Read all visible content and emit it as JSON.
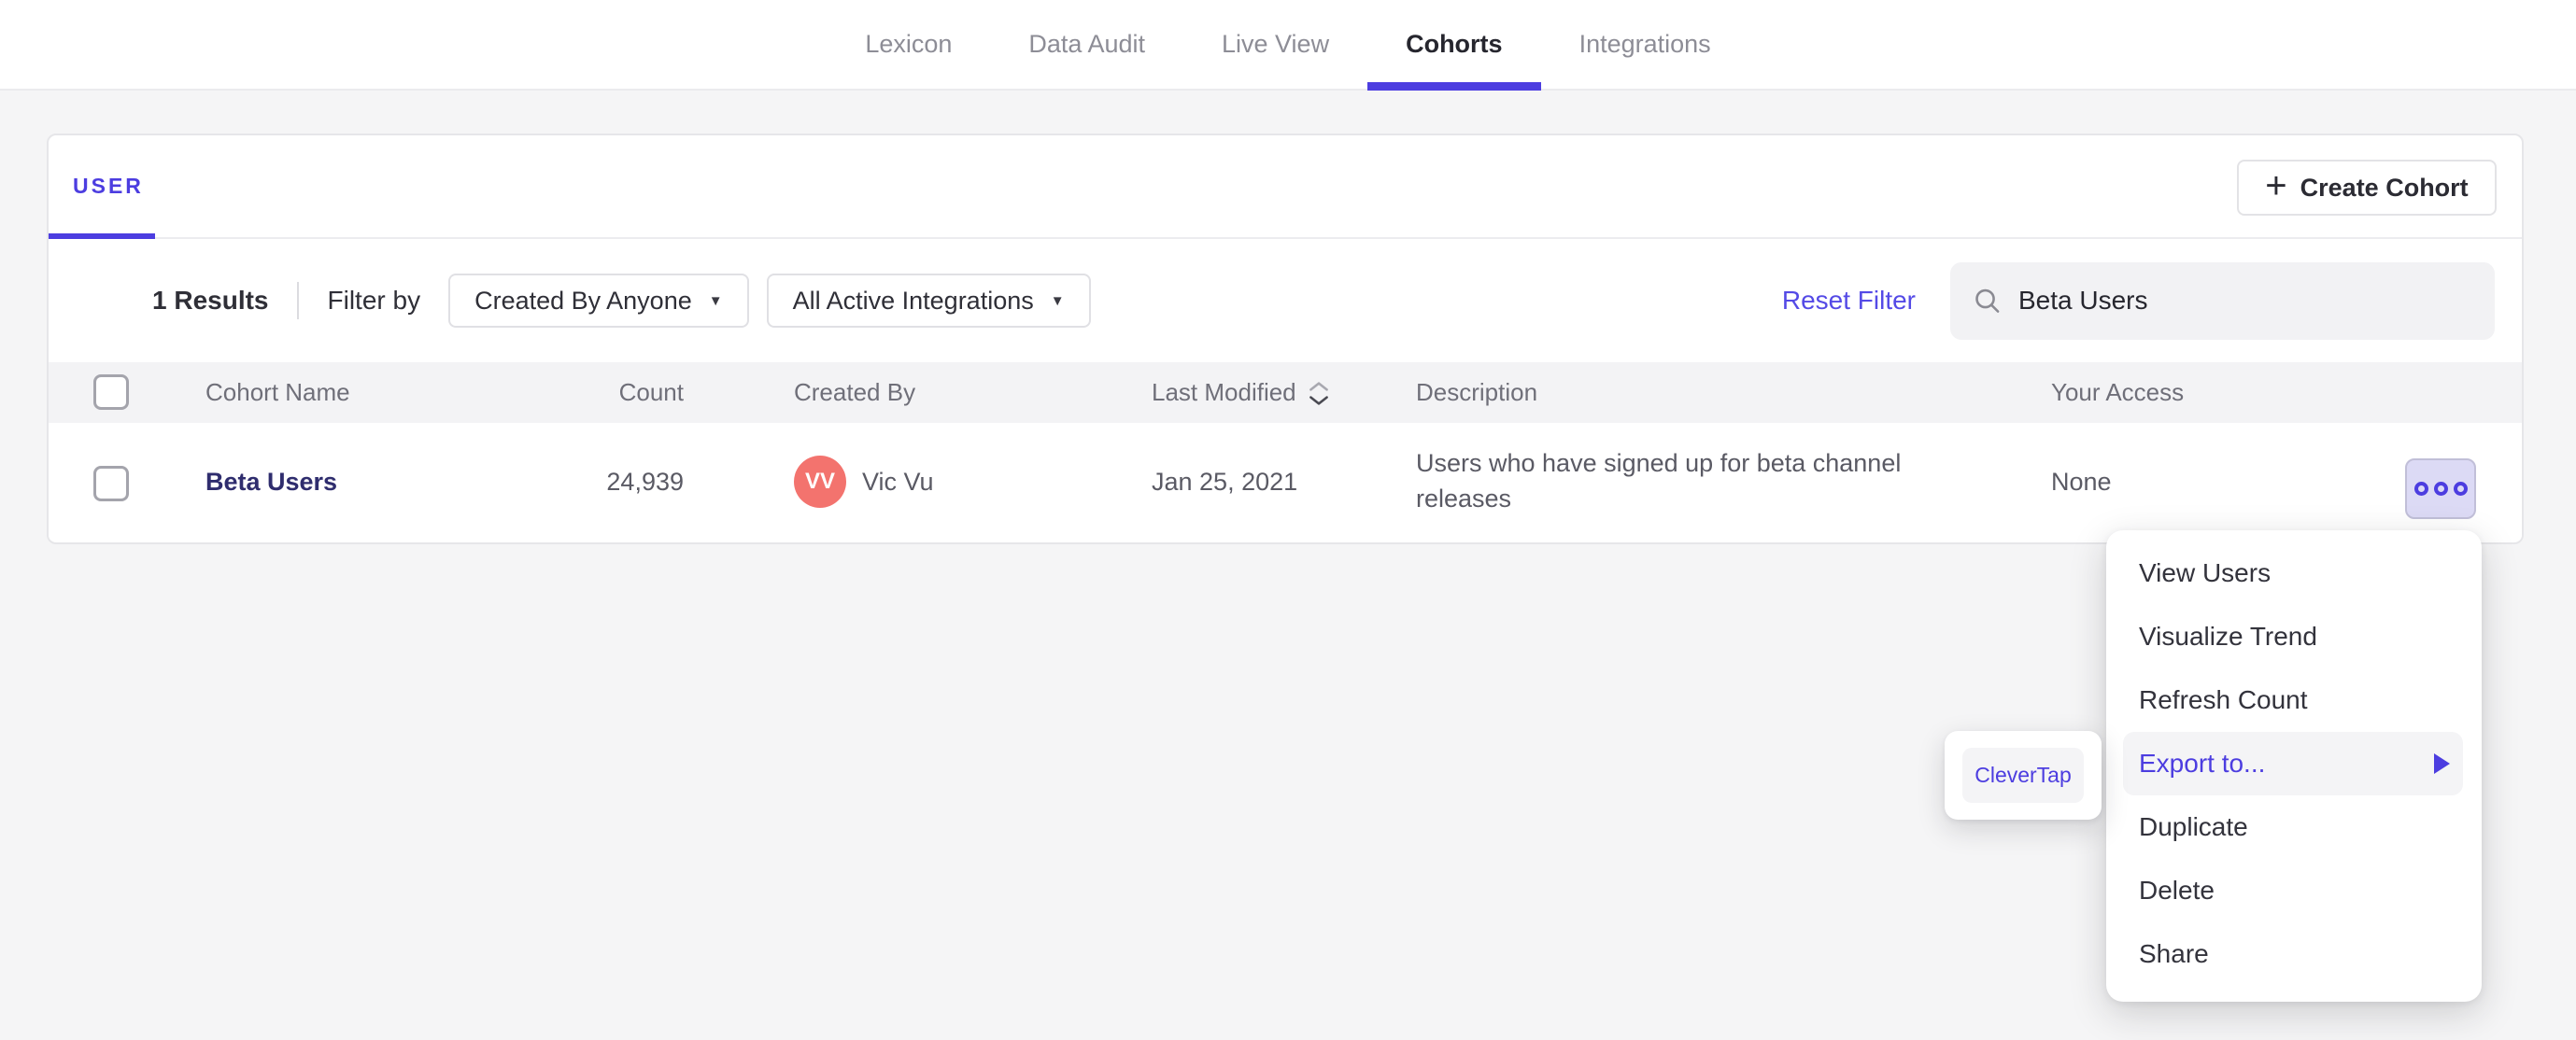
{
  "nav": {
    "tabs": [
      {
        "label": "Lexicon",
        "active": false
      },
      {
        "label": "Data Audit",
        "active": false
      },
      {
        "label": "Live View",
        "active": false
      },
      {
        "label": "Cohorts",
        "active": true
      },
      {
        "label": "Integrations",
        "active": false
      }
    ]
  },
  "panel": {
    "tab_label": "USER",
    "create_button": {
      "label": "Create Cohort",
      "icon_glyph": "+"
    },
    "filters": {
      "results_count": "1 Results",
      "filter_by_label": "Filter by",
      "created_by_dropdown": {
        "value": "Created By Anyone",
        "caret_glyph": "▼"
      },
      "integrations_dropdown": {
        "value": "All Active Integrations",
        "caret_glyph": "▼"
      },
      "reset_label": "Reset Filter",
      "search": {
        "value": "Beta Users"
      }
    },
    "table": {
      "columns": [
        "Cohort Name",
        "Count",
        "Created By",
        "Last Modified",
        "Description",
        "Your Access"
      ],
      "rows": [
        {
          "name": "Beta Users",
          "count": "24,939",
          "created_by": {
            "initials": "VV",
            "name": "Vic Vu"
          },
          "last_modified": "Jan 25, 2021",
          "description": "Users who have signed up for beta channel releases",
          "access": "None"
        }
      ]
    }
  },
  "context_menu": {
    "items": [
      {
        "label": "View Users",
        "highlighted": false
      },
      {
        "label": "Visualize Trend",
        "highlighted": false
      },
      {
        "label": "Refresh Count",
        "highlighted": false
      },
      {
        "label": "Export to...",
        "highlighted": true,
        "has_submenu": true
      },
      {
        "label": "Duplicate",
        "highlighted": false
      },
      {
        "label": "Delete",
        "highlighted": false
      },
      {
        "label": "Share",
        "highlighted": false
      }
    ]
  },
  "export_submenu": {
    "items": [
      {
        "label": "CleverTap"
      }
    ]
  },
  "colors": {
    "accent": "#4c3de0",
    "cohort_link": "#2f2d6e",
    "avatar": "#f3736e",
    "actions_button_bg": "#dcdaf5",
    "menu_highlight_bg": "#f4f4f6",
    "search_bg": "#f2f2f4",
    "table_header_bg": "#f3f3f5",
    "page_bg": "#f5f5f6"
  }
}
